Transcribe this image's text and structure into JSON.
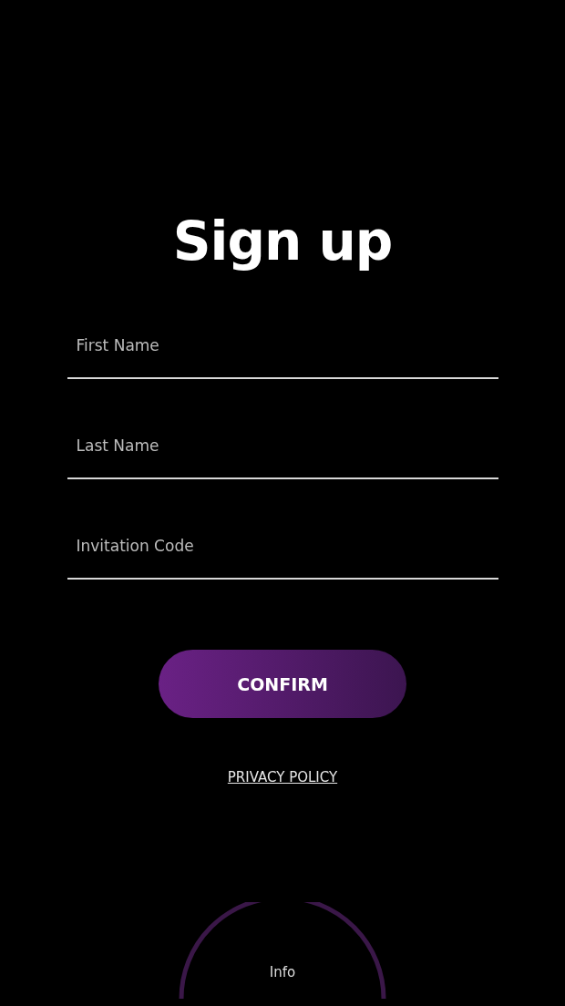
{
  "title": "Sign up",
  "fields": [
    {
      "placeholder": "First Name"
    },
    {
      "placeholder": "Last Name"
    },
    {
      "placeholder": "Invitation Code"
    }
  ],
  "confirm_button": "CONFIRM",
  "privacy_link": "PRIVACY POLICY",
  "info_button": "Info"
}
